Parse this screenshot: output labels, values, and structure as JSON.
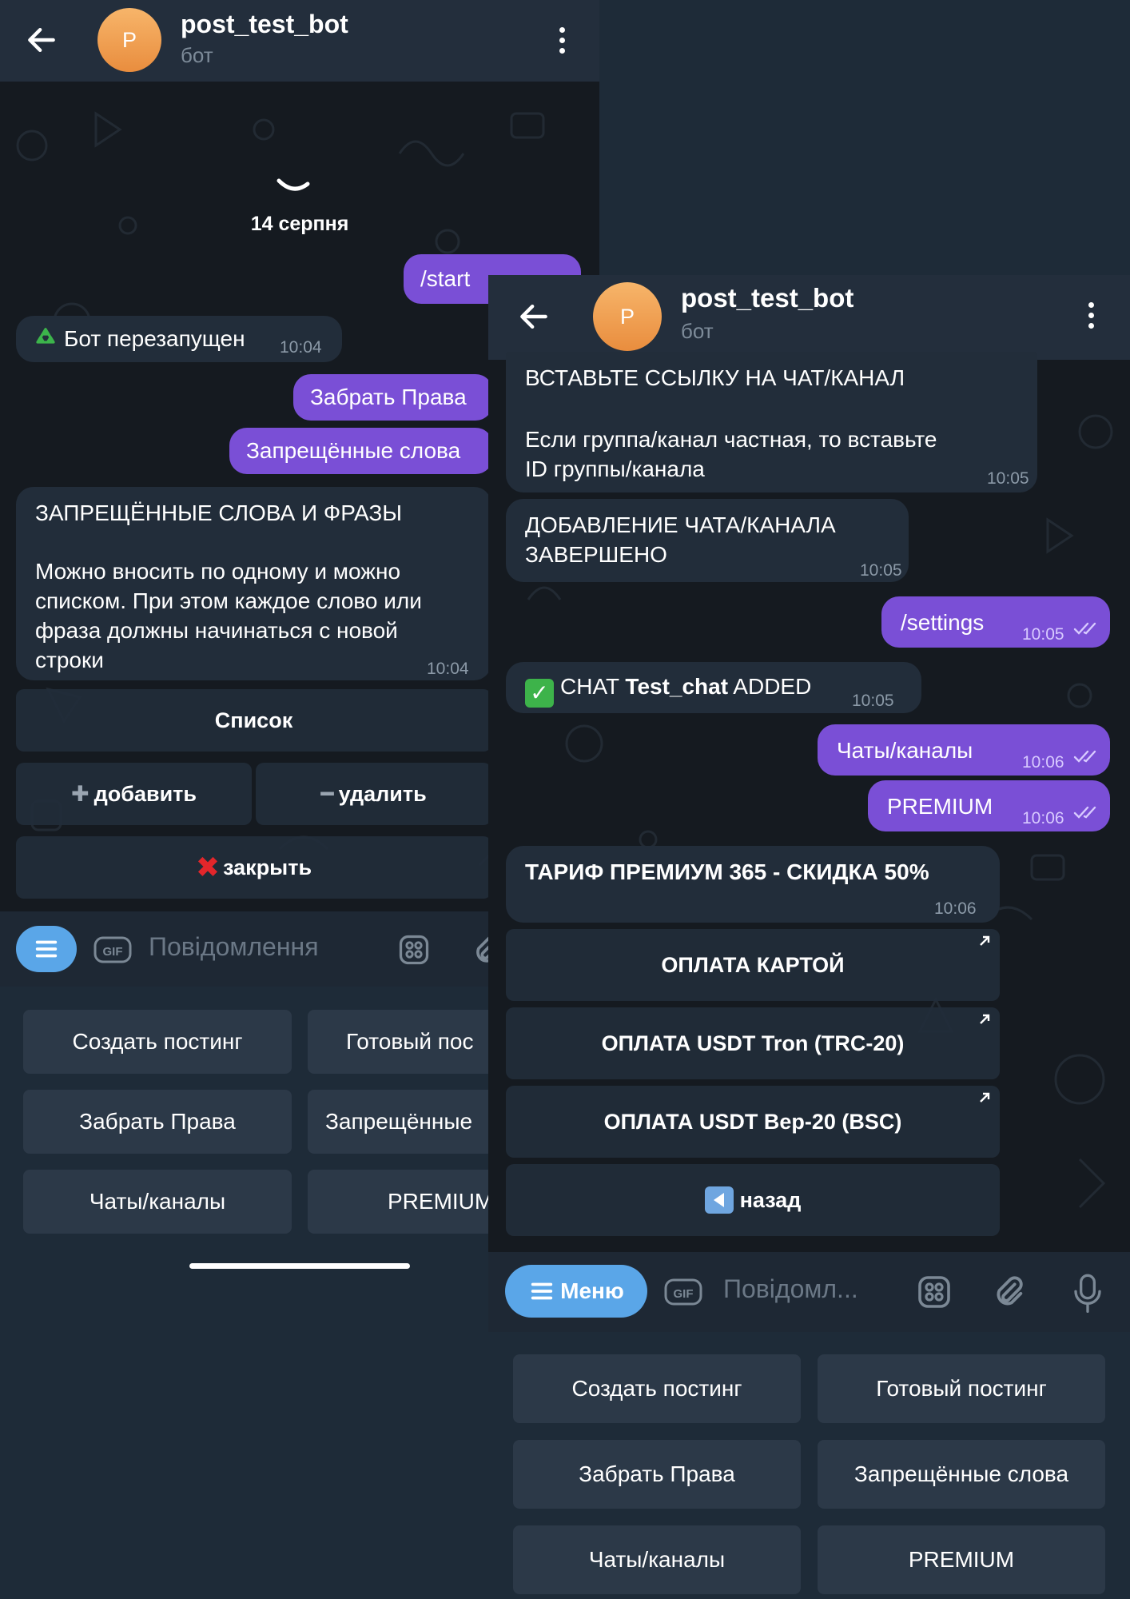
{
  "chat": {
    "bot_name": "post_test_bot",
    "status": "бот",
    "avatar_letter": "P"
  },
  "left": {
    "date": "14 серпня",
    "messages": {
      "m1": {
        "text": "/start"
      },
      "m2": {
        "text": "Бот перезапущен",
        "time": "10:04"
      },
      "m3": {
        "text": "Забрать Права"
      },
      "m4": {
        "text": "Запрещённые слова"
      },
      "m5": {
        "line1": "ЗАПРЕЩЁННЫЕ СЛОВА И ФРАЗЫ",
        "line2": "Можно вносить по одному и можно",
        "line3": "списком. При этом каждое слово или",
        "line4": "фраза должны начинаться с новой",
        "line5": "строки",
        "time": "10:04"
      }
    },
    "inline_keyboard": {
      "list": "Список",
      "add": "добавить",
      "remove": "удалить",
      "close": "закрыть"
    },
    "input_placeholder": "Повідомлення",
    "reply_keyboard": [
      "Создать постинг",
      "Готовый пос",
      "Забрать Права",
      "Запрещённые",
      "Чаты/каналы",
      "PREMIUM"
    ]
  },
  "right": {
    "messages": {
      "r1": {
        "line1": "ВСТАВЬТЕ ССЫЛКУ НА ЧАТ/КАНАЛ",
        "line2": "Если группа/канал частная, то вставьте",
        "line3": "ID группы/канала",
        "time": "10:05"
      },
      "r2": {
        "line1": "ДОБАВЛЕНИЕ ЧАТА/КАНАЛА",
        "line2": "ЗАВЕРШЕНО",
        "time": "10:05"
      },
      "r3": {
        "text": "/settings",
        "time": "10:05"
      },
      "r4": {
        "pre": "CHAT ",
        "bold": "Test_chat",
        "post": " ADDED",
        "time": "10:05"
      },
      "r5": {
        "text": "Чаты/каналы",
        "time": "10:06"
      },
      "r6": {
        "text": "PREMIUM",
        "time": "10:06"
      },
      "r7": {
        "text": "ТАРИФ ПРЕМИУМ 365 - СКИДКА 50%",
        "time": "10:06"
      }
    },
    "inline_keyboard": {
      "card": "ОПЛАТА КАРТОЙ",
      "trc": "ОПЛАТА USDT Tron (TRC-20)",
      "bep": "ОПЛАТА USDT Bep-20 (BSC)",
      "back": "назад"
    },
    "menu_label": "Меню",
    "input_placeholder": "Повідомл...",
    "reply_keyboard": [
      "Создать постинг",
      "Готовый постинг",
      "Забрать Права",
      "Запрещённые слова",
      "Чаты/каналы",
      "PREMIUM"
    ]
  },
  "colors": {
    "outgoing": "#7a4fd6",
    "incoming": "#222d3a",
    "menu": "#5aa6e8",
    "header": "#232e3c"
  }
}
